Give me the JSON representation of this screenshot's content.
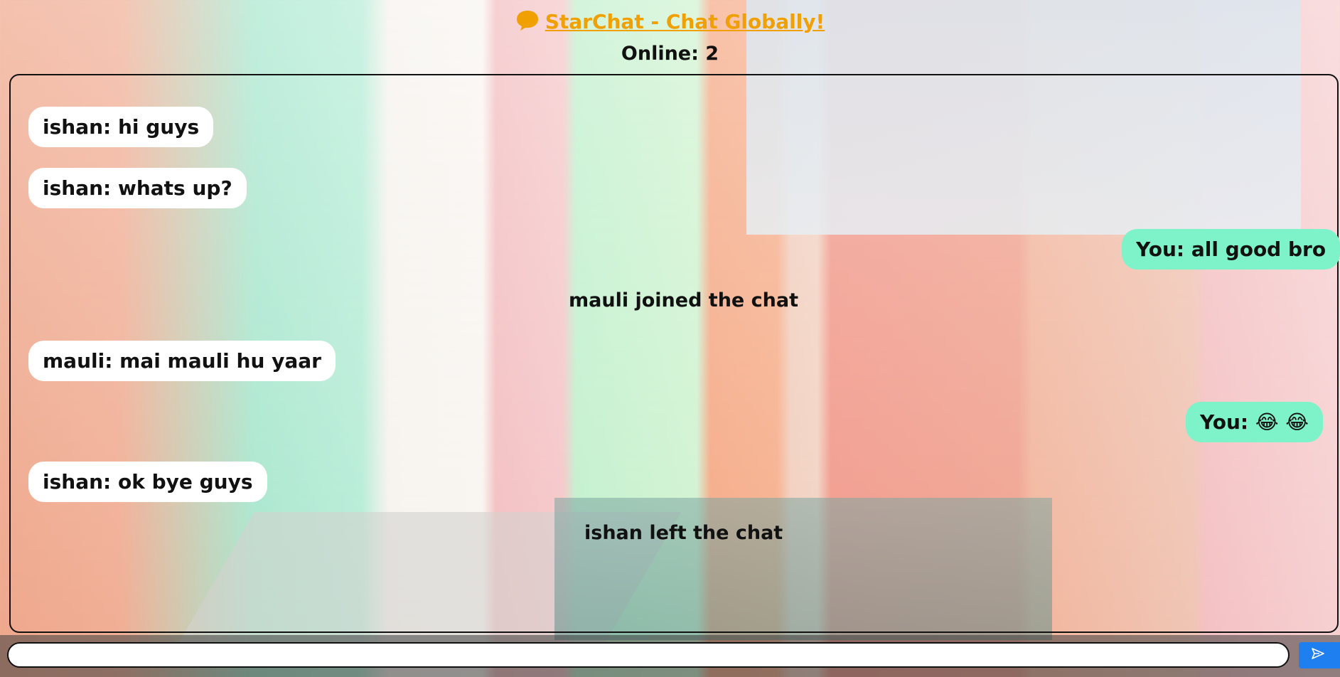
{
  "header": {
    "title": "StarChat - Chat Globally!",
    "title_icon": "chat-bubble-icon",
    "online_label": "Online: 2"
  },
  "messages": [
    {
      "kind": "incoming",
      "text": "ishan: hi guys"
    },
    {
      "kind": "incoming",
      "text": "ishan: whats up?"
    },
    {
      "kind": "outgoing",
      "text": "You: all good bro"
    },
    {
      "kind": "event",
      "text": "mauli joined the chat"
    },
    {
      "kind": "incoming",
      "text": "mauli: mai mauli hu yaar"
    },
    {
      "kind": "outgoing",
      "text": "You: 😂 😂"
    },
    {
      "kind": "incoming",
      "text": "ishan: ok bye guys"
    },
    {
      "kind": "event",
      "text": "ishan left the chat"
    }
  ],
  "composer": {
    "placeholder": "",
    "value": "",
    "send_icon": "send-arrow-icon"
  },
  "colors": {
    "title": "#f0a000",
    "incoming_bubble": "#ffffff",
    "outgoing_bubble": "#7ef2c8",
    "send_button": "#1e7ff0"
  }
}
